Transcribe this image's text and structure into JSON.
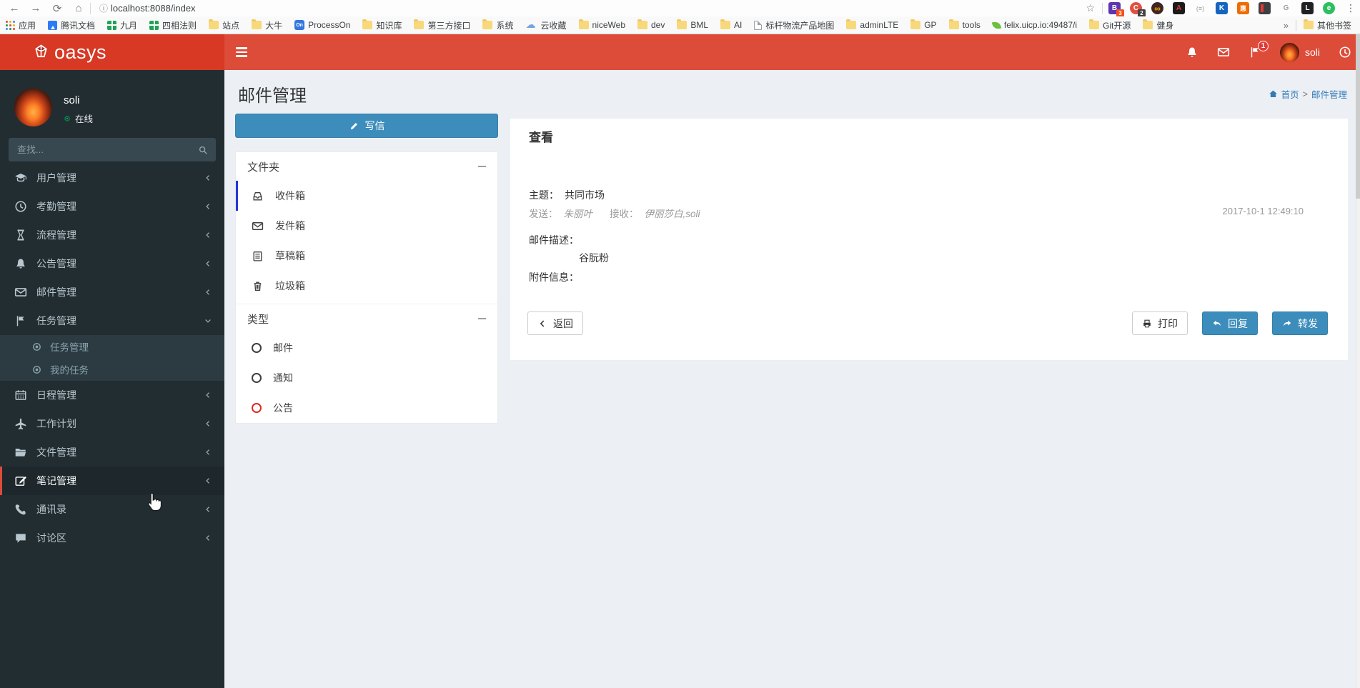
{
  "browser": {
    "url": "localhost:8088/index",
    "extensions": [
      {
        "glyph": "B",
        "badge": "3"
      },
      {
        "glyph": "C",
        "badge": "2"
      },
      {
        "glyph": "∞"
      },
      {
        "glyph": "A"
      },
      {
        "glyph": "(≡)"
      },
      {
        "glyph": "K"
      },
      {
        "glyph": "惠"
      },
      {
        "glyph": ""
      },
      {
        "glyph": "G"
      },
      {
        "glyph": "L"
      },
      {
        "glyph": "e"
      }
    ]
  },
  "bookmarks": {
    "items": [
      {
        "label": "应用"
      },
      {
        "label": "腾讯文档"
      },
      {
        "label": "九月"
      },
      {
        "label": "四相法则"
      },
      {
        "label": "站点"
      },
      {
        "label": "大牛"
      },
      {
        "label": "ProcessOn"
      },
      {
        "label": "知识库"
      },
      {
        "label": "第三方接口"
      },
      {
        "label": "系统"
      },
      {
        "label": "云收藏"
      },
      {
        "label": "niceWeb"
      },
      {
        "label": "dev"
      },
      {
        "label": "BML"
      },
      {
        "label": "AI"
      },
      {
        "label": "标杆物流产品地图"
      },
      {
        "label": "adminLTE"
      },
      {
        "label": "GP"
      },
      {
        "label": "tools"
      },
      {
        "label": "felix.uicp.io:49487/i"
      },
      {
        "label": "Git开源"
      },
      {
        "label": "健身"
      }
    ],
    "overflow": "»",
    "other_label": "其他书签"
  },
  "header": {
    "brand": "oasys",
    "flag_badge": "1",
    "username": "soli"
  },
  "sidebar": {
    "user": {
      "name": "soli",
      "status": "在线"
    },
    "search_placeholder": "查找...",
    "items": [
      {
        "label": "用户管理"
      },
      {
        "label": "考勤管理"
      },
      {
        "label": "流程管理"
      },
      {
        "label": "公告管理"
      },
      {
        "label": "邮件管理"
      },
      {
        "label": "任务管理",
        "children": [
          {
            "label": "任务管理"
          },
          {
            "label": "我的任务"
          }
        ]
      },
      {
        "label": "日程管理"
      },
      {
        "label": "工作计划"
      },
      {
        "label": "文件管理"
      },
      {
        "label": "笔记管理"
      },
      {
        "label": "通讯录"
      },
      {
        "label": "讨论区"
      }
    ]
  },
  "content": {
    "title": "邮件管理",
    "breadcrumb": {
      "home": "首页",
      "sep": ">",
      "current": "邮件管理"
    },
    "compose_label": "写信",
    "mail_sidebar": {
      "folders_header": "文件夹",
      "folders": [
        "收件箱",
        "发件箱",
        "草稿箱",
        "垃圾箱"
      ],
      "types_header": "类型",
      "types": [
        "邮件",
        "通知",
        "公告"
      ]
    },
    "view": {
      "heading": "查看",
      "subject_label": "主题：",
      "subject": "共同市场",
      "from_label": "发送：",
      "from": "朱丽叶",
      "to_label": "接收：",
      "to": "伊丽莎白,soli",
      "datetime": "2017-10-1 12:49:10",
      "desc_label": "邮件描述：",
      "desc": "谷朊粉",
      "attach_label": "附件信息：",
      "back_label": "返回",
      "print_label": "打印",
      "reply_label": "回复",
      "forward_label": "转发"
    }
  },
  "colors": {
    "navbar_red": "#dd4b39",
    "primary_blue": "#3c8dbc",
    "folder_active_border": "#2736d9",
    "type_announce_red": "#dd2c1e",
    "online_green": "#00a65a"
  }
}
